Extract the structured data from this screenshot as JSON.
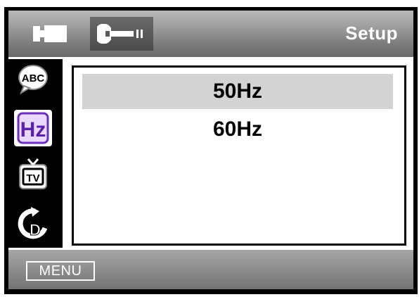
{
  "header": {
    "title": "Setup",
    "tabs": [
      {
        "icon": "camera-icon",
        "active": false
      },
      {
        "icon": "wrench-icon",
        "active": true
      }
    ]
  },
  "sidebar": {
    "items": [
      {
        "icon": "abc-icon",
        "selected": false
      },
      {
        "icon": "hz-icon",
        "selected": true
      },
      {
        "icon": "tv-out-icon",
        "selected": false
      },
      {
        "icon": "reset-icon",
        "selected": false
      }
    ]
  },
  "options": {
    "items": [
      {
        "label": "50Hz",
        "highlighted": true
      },
      {
        "label": "60Hz",
        "highlighted": false
      }
    ]
  },
  "footer": {
    "menu_label": "MENU"
  },
  "colors": {
    "header_gradient_top": "#b9b9b9",
    "header_gradient_bottom": "#6a6a6a",
    "highlight": "#d3d3d3",
    "hz_icon_accent": "#6b2fbf"
  }
}
